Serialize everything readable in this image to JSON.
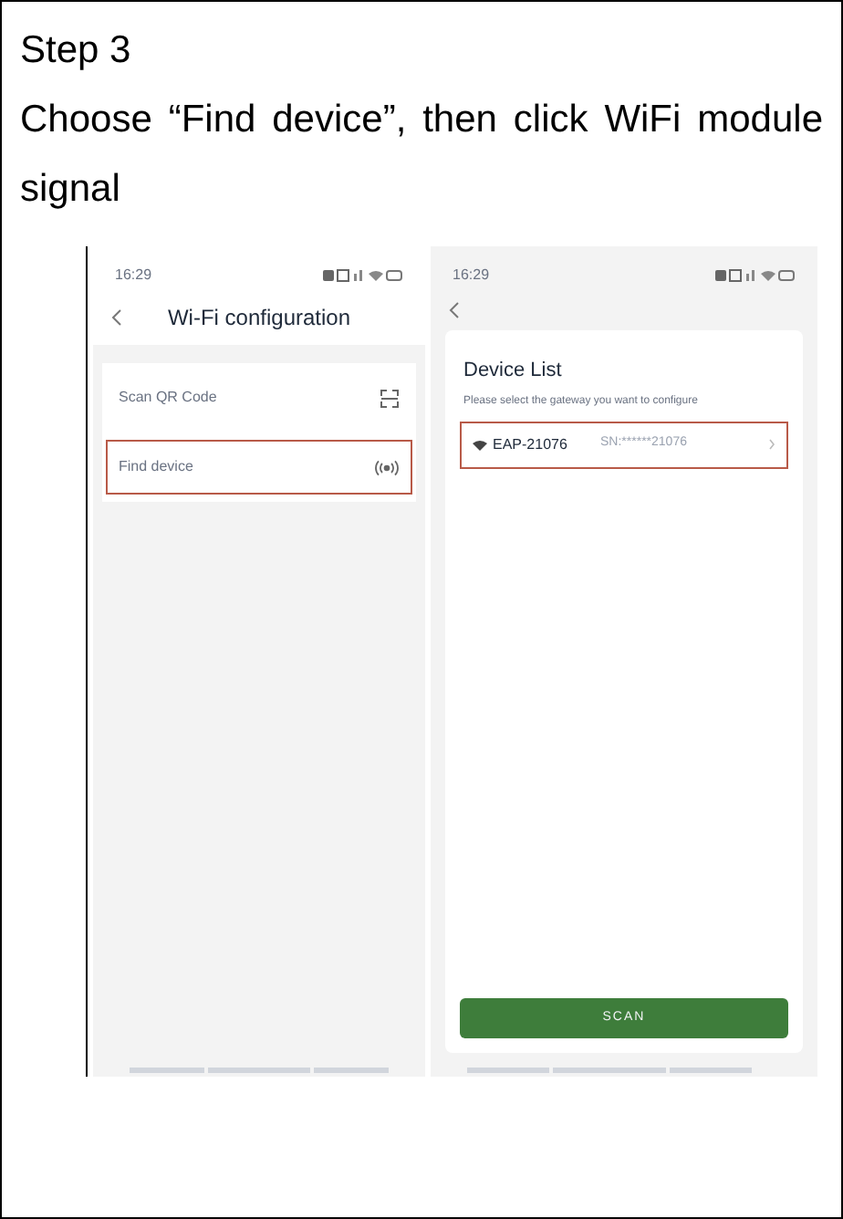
{
  "step": {
    "title": "Step 3",
    "instruction": "Choose “Find device”, then click WiFi module signal"
  },
  "screens": [
    {
      "kind": "wifi_config",
      "time": "16:29",
      "title": "Wi-Fi configuration",
      "options": [
        {
          "kind": "qr",
          "label": "Scan QR Code",
          "highlighted": false
        },
        {
          "kind": "signal",
          "label": "Find device",
          "highlighted": true
        }
      ]
    },
    {
      "kind": "device_list",
      "time": "16:29",
      "heading": "Device List",
      "hint": "Please select the gateway you want to configure",
      "devices": [
        {
          "name": "EAP-21076",
          "serial": "SN:******21076",
          "highlighted": true
        }
      ],
      "button": "SCAN"
    }
  ]
}
